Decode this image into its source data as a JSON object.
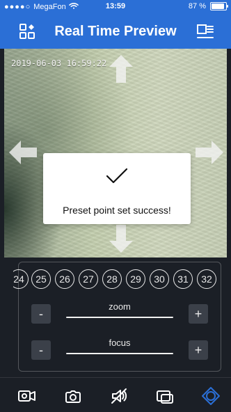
{
  "status_bar": {
    "carrier": "MegaFon",
    "time": "13:59",
    "battery": "87 %"
  },
  "header": {
    "title": "Real Time Preview",
    "left_icon": "grid-icon",
    "right_icon": "menu-icon"
  },
  "preview": {
    "timestamp": "2019-06-03 16:59:22",
    "arrows": [
      "arrow-up-icon",
      "arrow-down-icon",
      "arrow-left-icon",
      "arrow-right-icon"
    ]
  },
  "toast": {
    "message": "Preset point set success!",
    "icon": "checkmark-icon"
  },
  "controls": {
    "preset_numbers": [
      "24",
      "25",
      "26",
      "27",
      "28",
      "29",
      "30",
      "31",
      "32"
    ],
    "zoom": {
      "label": "zoom",
      "minus": "-",
      "plus": "+"
    },
    "focus": {
      "label": "focus",
      "minus": "-",
      "plus": "+"
    }
  },
  "toolbar": {
    "items": [
      "video-record-icon",
      "camera-icon",
      "mute-icon",
      "multi-window-icon",
      "ptz-icon"
    ],
    "active_color": "#2b6fd6"
  }
}
